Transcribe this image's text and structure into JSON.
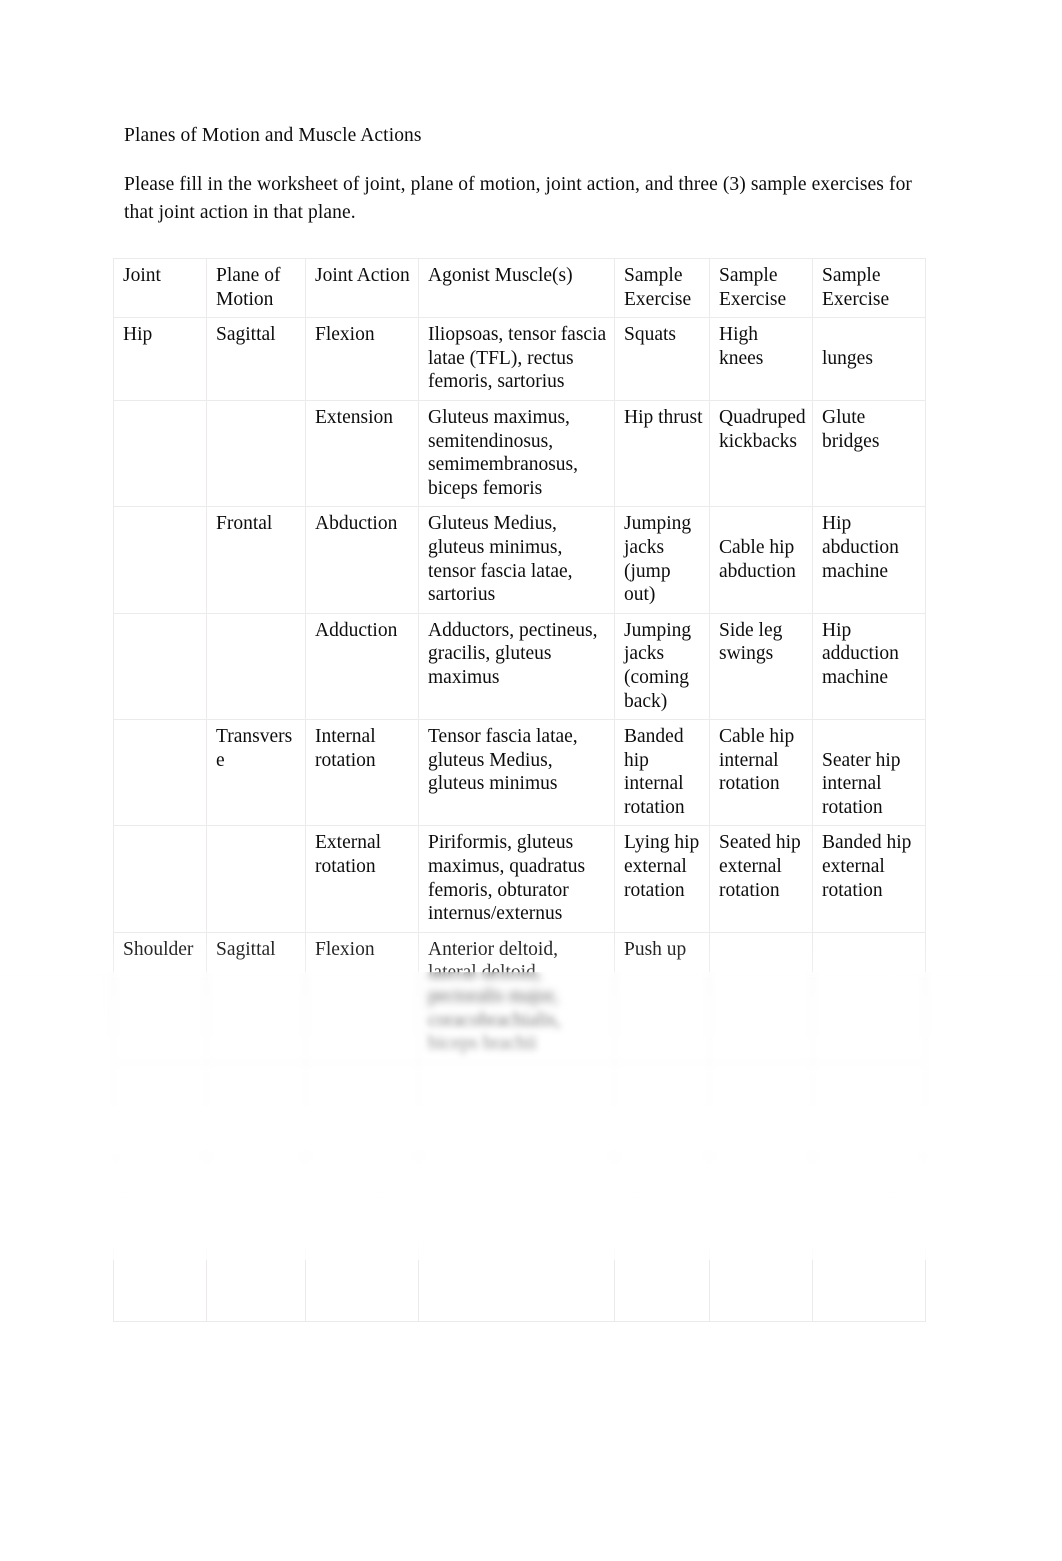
{
  "document": {
    "title": "Planes of Motion and Muscle Actions",
    "instructions": "Please fill in the worksheet of joint, plane of motion, joint action, and three (3) sample exercises for that joint action in that plane."
  },
  "table": {
    "headers": [
      "Joint",
      "Plane of Motion",
      "Joint Action",
      "Agonist Muscle(s)",
      "Sample Exercise",
      "Sample Exercise",
      "Sample Exercise"
    ],
    "rows": [
      {
        "joint": "Hip",
        "plane": "Sagittal",
        "action": "Flexion",
        "muscles": "Iliopsoas, tensor fascia latae (TFL), rectus femoris, sartorius",
        "exercise1": "Squats",
        "exercise2": "High knees",
        "exercise3": "lunges",
        "exercise3_offset": true,
        "blurred": false
      },
      {
        "joint": "",
        "plane": "",
        "action": "Extension",
        "muscles": "Gluteus maximus, semitendinosus, semimembranosus, biceps femoris",
        "exercise1": "Hip thrust",
        "exercise2": "Quadruped kickbacks",
        "exercise3": "Glute bridges",
        "blurred": false
      },
      {
        "joint": "",
        "plane": "Frontal",
        "action": "Abduction",
        "muscles": "Gluteus Medius, gluteus minimus, tensor fascia latae, sartorius",
        "exercise1": "Jumping jacks (jump out)",
        "exercise2": "Cable hip abduction",
        "exercise2_offset": true,
        "exercise3": "Hip abduction machine",
        "blurred": false
      },
      {
        "joint": "",
        "plane": "",
        "action": "Adduction",
        "muscles": "Adductors, pectineus, gracilis, gluteus maximus",
        "exercise1": "Jumping jacks (coming back)",
        "exercise2": "Side leg swings",
        "exercise3": "Hip adduction machine",
        "blurred": false
      },
      {
        "joint": "",
        "plane": "Transverse",
        "action": "Internal rotation",
        "muscles": "Tensor fascia latae, gluteus Medius, gluteus minimus",
        "exercise1": "Banded hip internal rotation",
        "exercise2": "Cable hip internal rotation",
        "exercise3": "Seater hip internal rotation",
        "exercise3_offset": true,
        "blurred": false
      },
      {
        "joint": "",
        "plane": "",
        "action": "External rotation",
        "muscles": "Piriformis, gluteus maximus, quadratus femoris, obturator internus/externus",
        "exercise1": "Lying hip external rotation",
        "exercise2": "Seated hip external rotation",
        "exercise3": "Banded hip external rotation",
        "blurred": false
      },
      {
        "joint": "Shoulder",
        "plane": "Sagittal",
        "action": "Flexion",
        "muscles": "Anterior deltoid, lateral deltoid, pectoralis major, coracobrachialis, biceps brachii",
        "exercise1": "Push up",
        "exercise2": "",
        "exercise3": "",
        "blurred": false
      },
      {
        "joint": "",
        "plane": "",
        "action": "",
        "muscles": "",
        "exercise1": "",
        "exercise2": "",
        "exercise3": "",
        "blurred": true
      },
      {
        "joint": "",
        "plane": "",
        "action": "",
        "muscles": "",
        "exercise1": "",
        "exercise2": "",
        "exercise3": "",
        "blurred": true
      },
      {
        "joint": "",
        "plane": "",
        "action": "",
        "muscles": "",
        "exercise1": "",
        "exercise2": "",
        "exercise3": "",
        "blurred": true
      }
    ]
  }
}
